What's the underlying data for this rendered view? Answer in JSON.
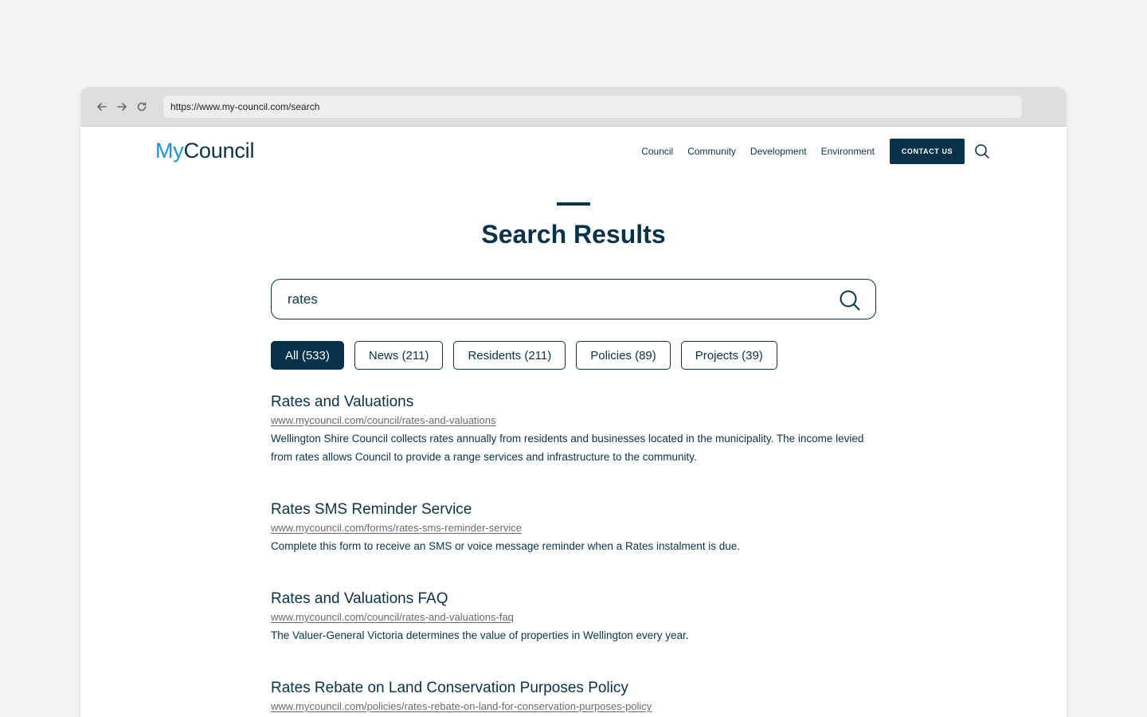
{
  "browser": {
    "url": "https://www.my-council.com/search",
    "back_icon": "arrow-left-icon",
    "forward_icon": "arrow-right-icon",
    "reload_icon": "reload-icon"
  },
  "header": {
    "logo_prefix": "My",
    "logo_suffix": "Council",
    "nav": [
      "Council",
      "Community",
      "Development",
      "Environment"
    ],
    "contact_label": "CONTACT US",
    "search_icon": "search-icon"
  },
  "page": {
    "title": "Search Results"
  },
  "search": {
    "value": "rates"
  },
  "filters": [
    {
      "label": "All (533)",
      "active": true
    },
    {
      "label": "News (211)",
      "active": false
    },
    {
      "label": "Residents (211)",
      "active": false
    },
    {
      "label": "Policies (89)",
      "active": false
    },
    {
      "label": "Projects (39)",
      "active": false
    }
  ],
  "results": [
    {
      "title": "Rates and Valuations",
      "url": "www.mycouncil.com/council/rates-and-valuations",
      "description": "Wellington Shire Council collects rates annually from residents and businesses located in the municipality. The income levied from rates allows Council to provide a range services and infrastructure to the community."
    },
    {
      "title": "Rates SMS Reminder Service",
      "url": "www.mycouncil.com/forms/rates-sms-reminder-service",
      "description": "Complete this form to receive an SMS or voice message reminder when a Rates instalment is due."
    },
    {
      "title": "Rates and Valuations FAQ",
      "url": "www.mycouncil.com/council/rates-and-valuations-faq",
      "description": "The Valuer-General Victoria determines the value of properties in Wellington every year."
    },
    {
      "title": "Rates Rebate on Land Conservation Purposes Policy",
      "url": "www.mycouncil.com/policies/rates-rebate-on-land-for-conservation-purposes-policy",
      "description": ""
    }
  ],
  "colors": {
    "brand_dark": "#08324a",
    "brand_light": "#1a93d6",
    "page_bg": "#f5f5f5"
  }
}
